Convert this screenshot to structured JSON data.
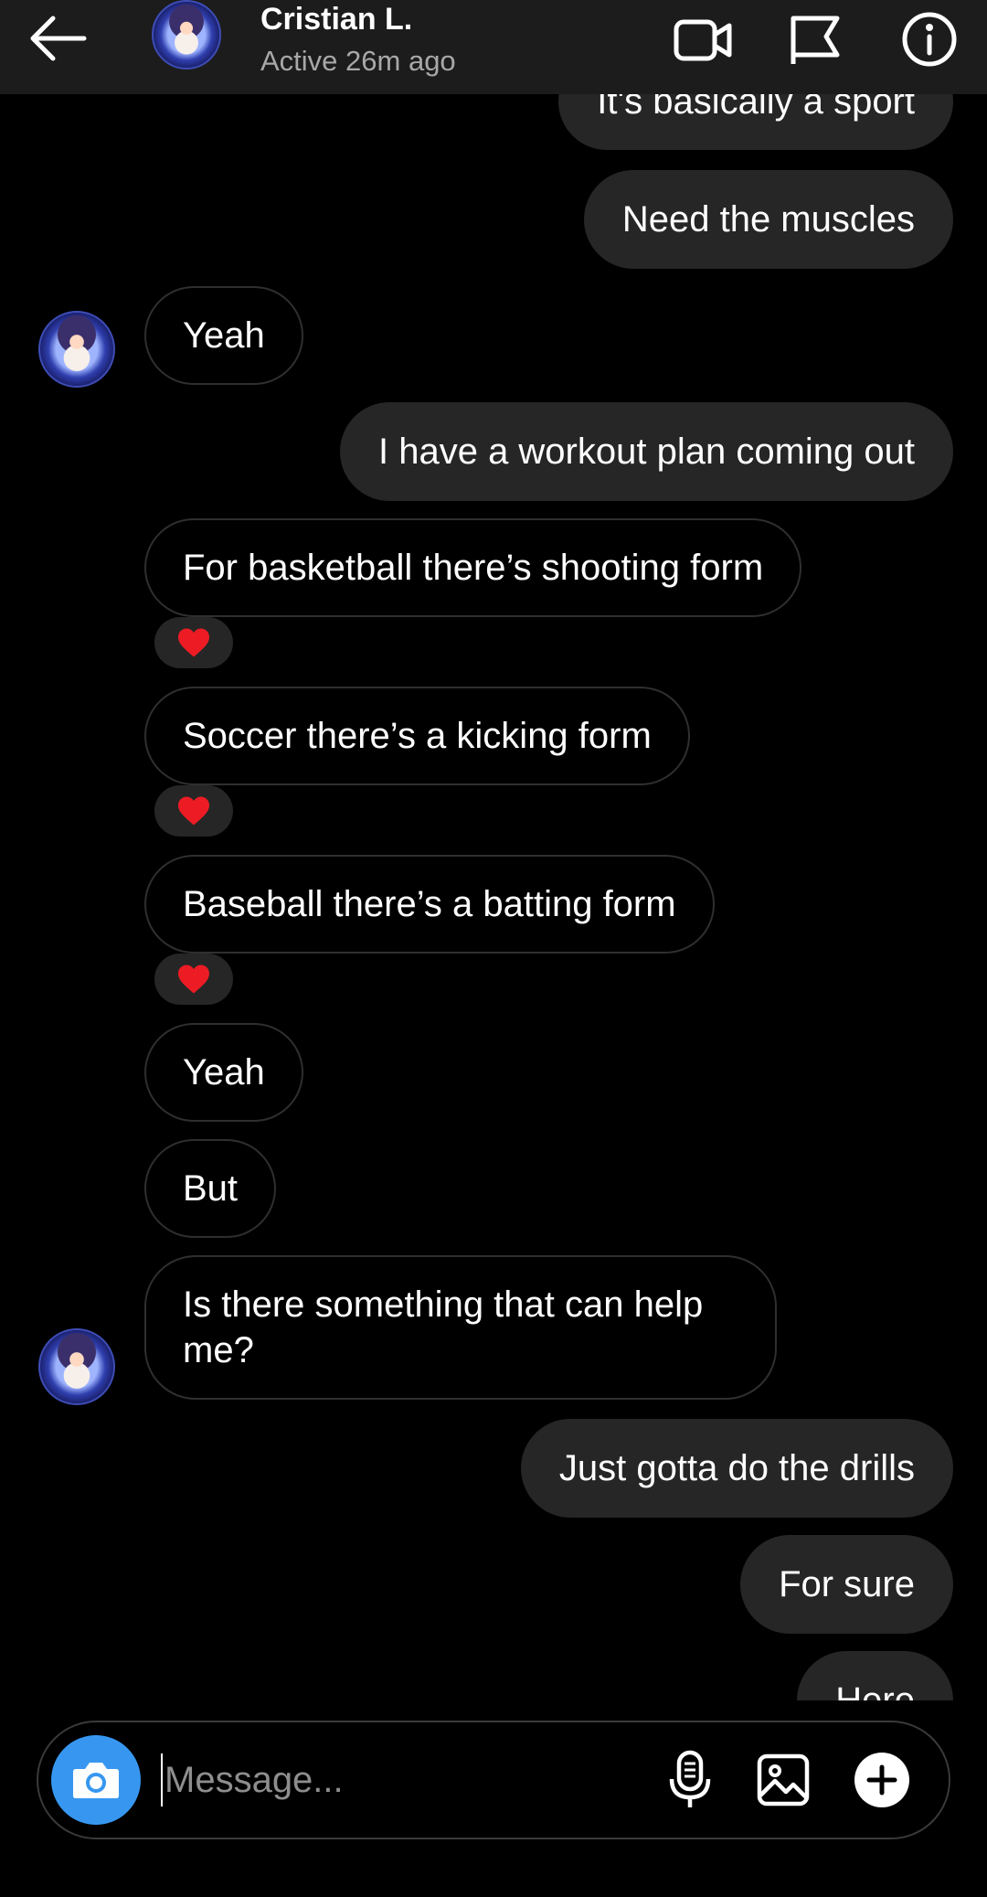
{
  "header": {
    "name": "Cristian L.",
    "status": "Active 26m ago"
  },
  "messages": [
    {
      "side": "sent",
      "text": "It's basically a sport"
    },
    {
      "side": "sent",
      "text": "Need the muscles"
    },
    {
      "side": "recv",
      "text": "Yeah"
    },
    {
      "side": "sent",
      "text": "I have a workout plan coming out"
    },
    {
      "side": "recv",
      "text": "For basketball there’s shooting form",
      "reaction": "heart"
    },
    {
      "side": "recv",
      "text": "Soccer there’s a kicking form",
      "reaction": "heart"
    },
    {
      "side": "recv",
      "text": "Baseball there’s a batting form",
      "reaction": "heart"
    },
    {
      "side": "recv",
      "text": "Yeah"
    },
    {
      "side": "recv",
      "text": "But"
    },
    {
      "side": "recv",
      "text": "Is there something that can help me?"
    },
    {
      "side": "sent",
      "text": "Just gotta do the drills"
    },
    {
      "side": "sent",
      "text": "For sure"
    },
    {
      "side": "sent",
      "text": "Here"
    }
  ],
  "composer": {
    "placeholder": "Message..."
  },
  "icons": {
    "back": "arrow-left-icon",
    "video": "video-call-icon",
    "flag": "flag-icon",
    "info": "info-icon",
    "camera": "camera-icon",
    "mic": "microphone-icon",
    "gallery": "image-icon",
    "add": "plus-circle-icon",
    "reaction": "heart-icon"
  },
  "colors": {
    "accent": "#3797f0",
    "sent_bubble": "#262626",
    "heart": "#ed1c24"
  }
}
